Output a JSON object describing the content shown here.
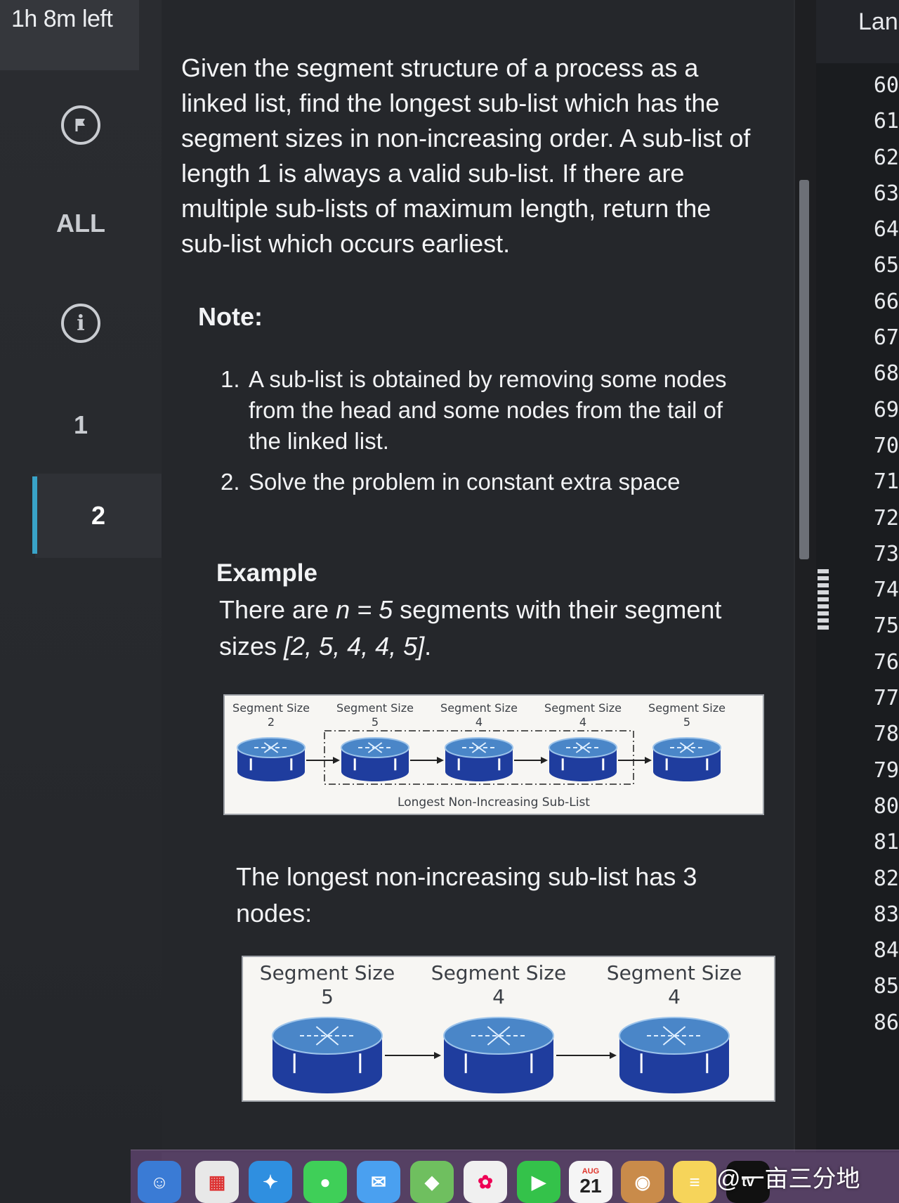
{
  "timer": "1h 8m left",
  "sidebar": {
    "items": [
      {
        "label": "",
        "icon": "flag-icon"
      },
      {
        "label": "ALL"
      },
      {
        "label": "",
        "icon": "info-icon"
      },
      {
        "label": "1"
      },
      {
        "label": "2",
        "active": true
      }
    ]
  },
  "problem": {
    "statement": "Given the segment structure of a process as a linked list, find the longest sub-list which has the segment sizes in non-increasing order. A sub-list of length 1 is always a valid sub-list. If there are multiple sub-lists of maximum length, return the sub-list which occurs earliest.",
    "note_heading": "Note:",
    "notes": [
      {
        "num": "1.",
        "text": "A sub-list is obtained by removing some nodes from the head and some nodes from the tail of the linked list."
      },
      {
        "num": "2.",
        "text": "Solve the problem in constant extra space"
      }
    ],
    "example_heading": "Example",
    "example_pre": "There are ",
    "example_var": "n = 5",
    "example_mid": " segments with their segment sizes ",
    "example_sizes": "[2, 5, 4, 4, 5]",
    "example_end": ".",
    "figure1": {
      "segment_label": "Segment Size",
      "sizes": [
        "2",
        "5",
        "4",
        "4",
        "5"
      ],
      "caption": "Longest Non-Increasing Sub-List"
    },
    "result_text": "The longest non-increasing sub-list has 3 nodes:",
    "figure2": {
      "segment_label": "Segment Size",
      "sizes": [
        "5",
        "4",
        "4"
      ]
    }
  },
  "editor": {
    "language_label": "Lan",
    "line_numbers": [
      "60",
      "61",
      "62",
      "63",
      "64",
      "65",
      "66",
      "67",
      "68",
      "69",
      "70",
      "71",
      "72",
      "73",
      "74",
      "75",
      "76",
      "77",
      "78",
      "79",
      "80",
      "81",
      "82",
      "83",
      "84",
      "85",
      "86"
    ]
  },
  "dock": {
    "calendar_month": "AUG",
    "calendar_day": "21",
    "tv_label": "tv",
    "watermark": "@一亩三分地"
  },
  "colors": {
    "accent": "#39a3c8",
    "panel_bg": "#25272b",
    "disk_top": "#4a86c8",
    "disk_side": "#1f3d9e"
  }
}
